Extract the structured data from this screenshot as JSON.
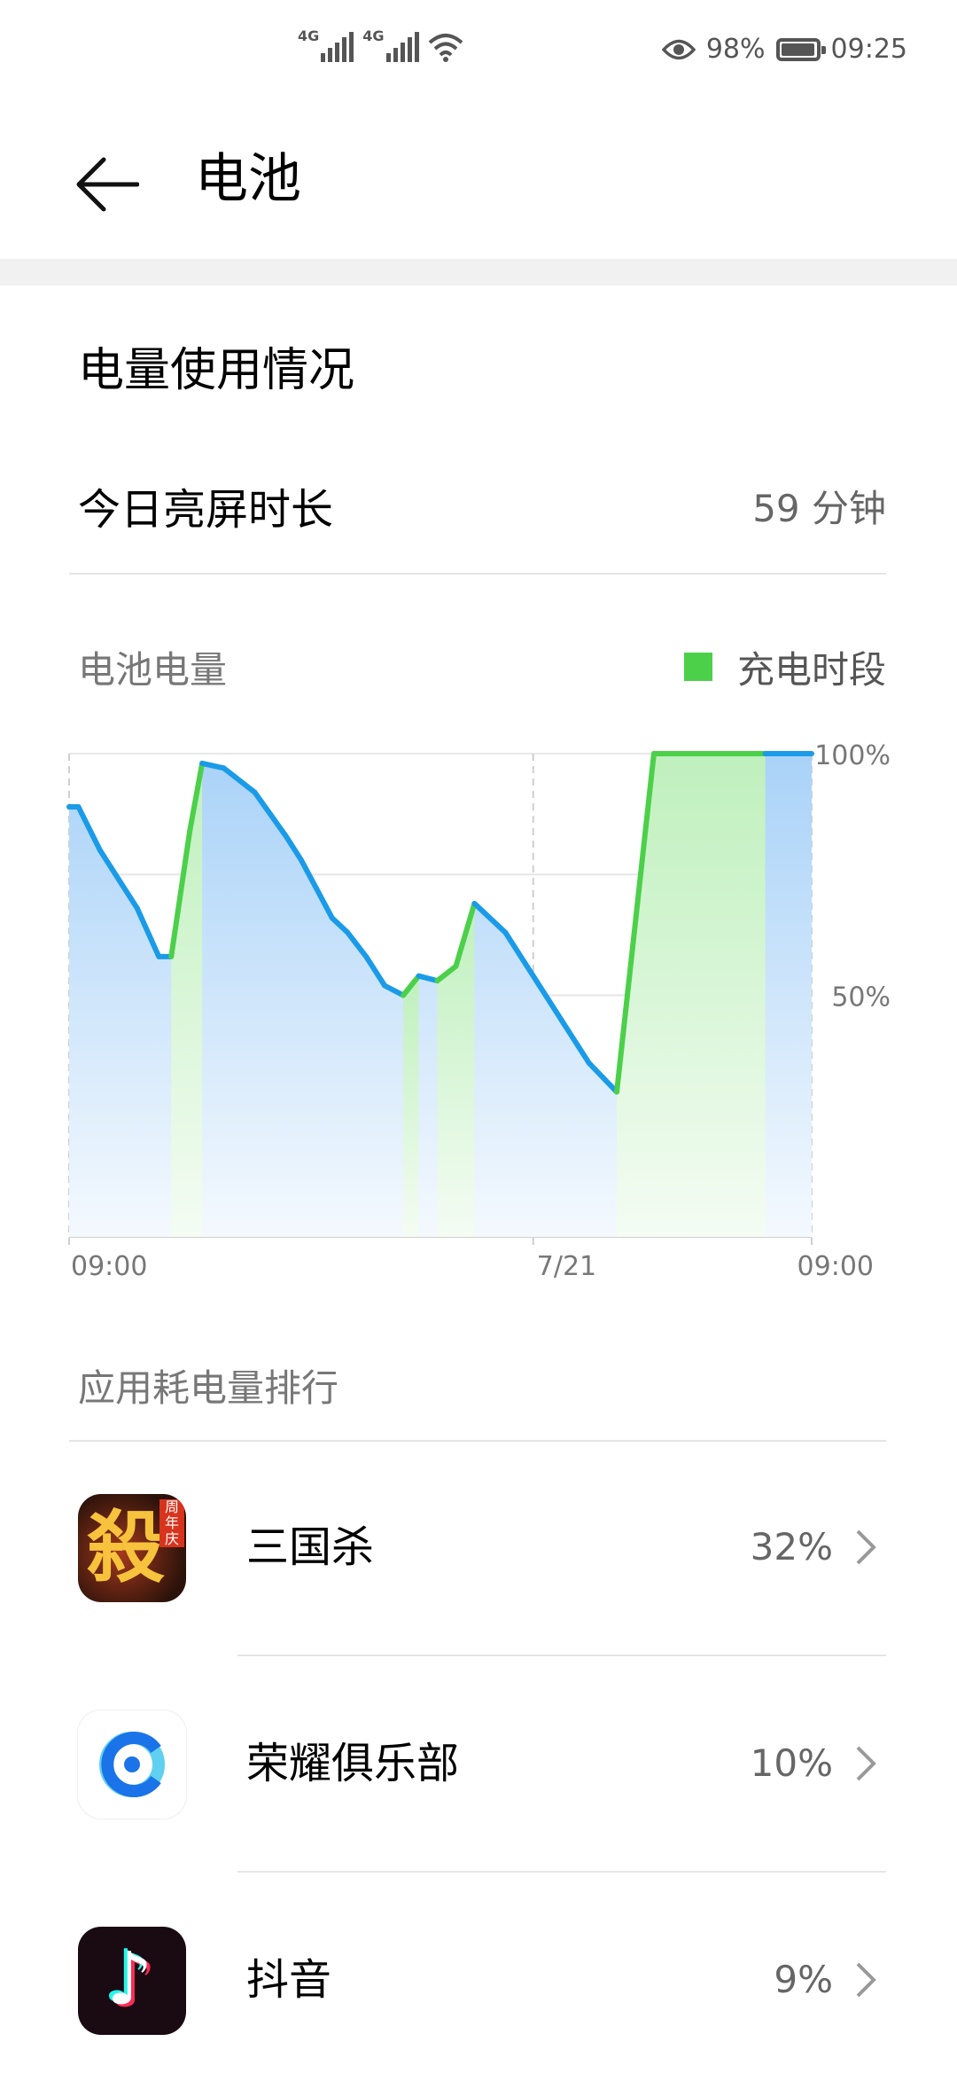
{
  "status_bar": {
    "network1": "4G",
    "network2": "4G",
    "battery_percent": "98%",
    "battery_level": 0.98,
    "time": "09:25"
  },
  "header": {
    "title": "电池"
  },
  "usage": {
    "section_title": "电量使用情况",
    "screen_time_label": "今日亮屏时长",
    "screen_time_value": "59 分钟"
  },
  "battery_chart": {
    "title": "电池电量",
    "legend_label": "充电时段",
    "colors": {
      "discharge": "#1a9be8",
      "charging": "#4cd04a"
    }
  },
  "chart_data": {
    "type": "line",
    "title": "电池电量",
    "y_ticks": [
      "100%",
      "50%"
    ],
    "x_ticks": [
      "09:00",
      "7/21",
      "09:00"
    ],
    "ylim": [
      0,
      100
    ],
    "x_unit": "hours since 09:00",
    "series": [
      {
        "name": "充电时段",
        "points": [
          [
            0.0,
            89
          ],
          [
            0.3,
            89
          ],
          [
            1.0,
            80
          ],
          [
            1.6,
            74
          ],
          [
            2.2,
            68
          ],
          [
            2.9,
            58
          ],
          [
            3.3,
            58
          ],
          [
            3.9,
            84
          ],
          [
            4.3,
            98
          ],
          [
            5.0,
            97
          ],
          [
            6.0,
            92
          ],
          [
            7.0,
            83
          ],
          [
            7.5,
            78
          ],
          [
            8.0,
            72
          ],
          [
            8.5,
            66
          ],
          [
            9.0,
            63
          ],
          [
            9.6,
            58
          ],
          [
            10.2,
            52
          ],
          [
            10.8,
            50
          ],
          [
            11.3,
            54
          ],
          [
            11.9,
            53
          ],
          [
            12.5,
            56
          ],
          [
            13.1,
            69
          ],
          [
            14.1,
            63
          ],
          [
            15.1,
            53
          ],
          [
            16.0,
            44
          ],
          [
            16.8,
            36
          ],
          [
            17.7,
            30
          ],
          [
            18.9,
            100
          ],
          [
            22.5,
            100
          ],
          [
            24.0,
            100
          ]
        ],
        "charging_spans": [
          [
            3.3,
            4.3
          ],
          [
            10.8,
            11.3
          ],
          [
            11.9,
            13.1
          ],
          [
            17.7,
            22.5
          ]
        ]
      }
    ]
  },
  "ranking": {
    "title": "应用耗电量排行",
    "apps": [
      {
        "name": "三国杀",
        "percent": "32%",
        "icon": "sanguosha-app-icon",
        "badge": "周年庆",
        "glyph": "殺"
      },
      {
        "name": "荣耀俱乐部",
        "percent": "10%",
        "icon": "honor-club-app-icon"
      },
      {
        "name": "抖音",
        "percent": "9%",
        "icon": "douyin-app-icon",
        "glyph": "♪"
      }
    ]
  }
}
